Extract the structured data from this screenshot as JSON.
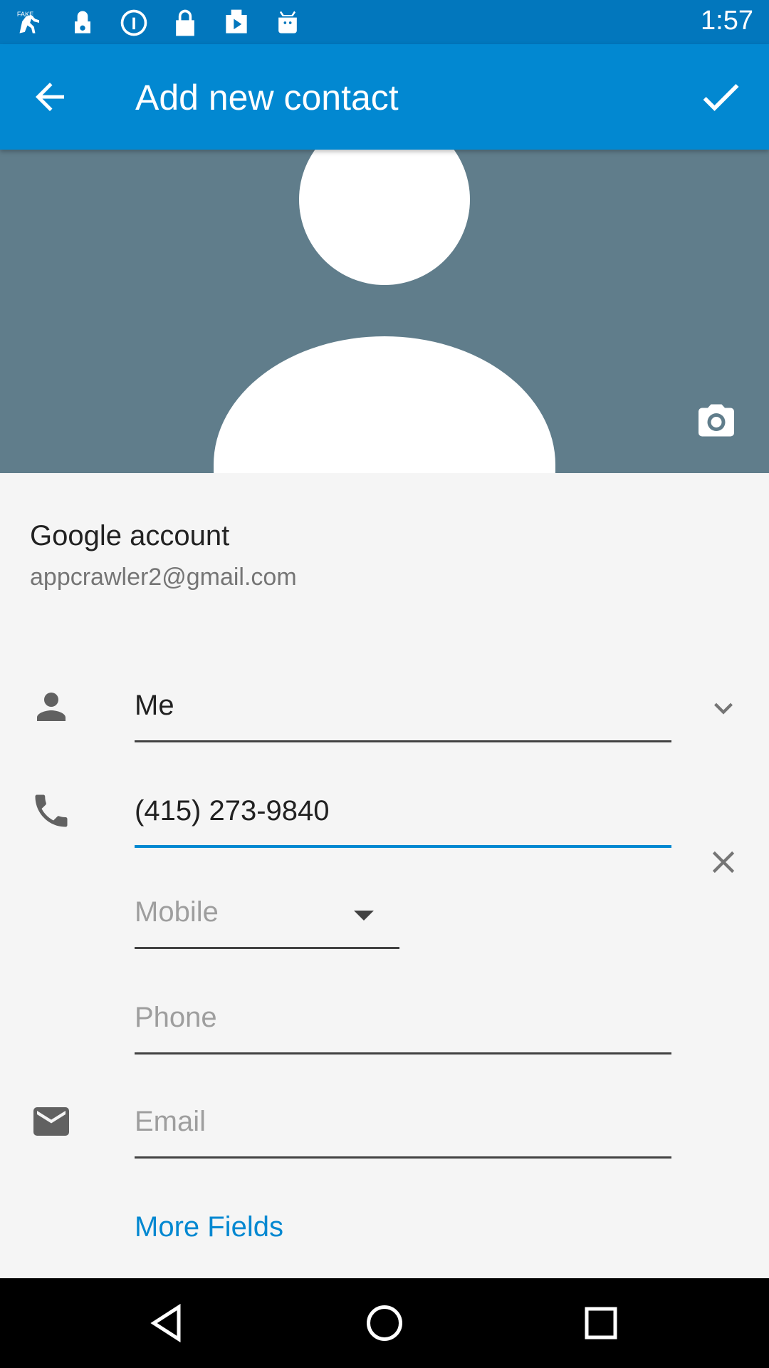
{
  "status_bar": {
    "time": "1:57",
    "icons": [
      "fake-gps-icon",
      "alarm-icon",
      "info-icon",
      "lock-icon",
      "play-store-icon",
      "android-icon"
    ]
  },
  "app_bar": {
    "title": "Add new contact",
    "back_icon": "arrow-back-icon",
    "done_icon": "check-icon"
  },
  "photo": {
    "placeholder_icon": "person-avatar-icon",
    "camera_icon": "camera-icon"
  },
  "account": {
    "label": "Google account",
    "email": "appcrawler2@gmail.com"
  },
  "name": {
    "value": "Me",
    "icon": "person-icon",
    "expand_icon": "chevron-down-icon"
  },
  "phone": {
    "value": "(415) 273-9840",
    "icon": "phone-icon",
    "clear_icon": "close-icon",
    "type_selected": "Mobile",
    "new_placeholder": "Phone"
  },
  "email": {
    "placeholder": "Email",
    "icon": "email-icon"
  },
  "more_fields_label": "More Fields",
  "nav": {
    "back": "back-triangle-icon",
    "home": "home-circle-icon",
    "recents": "recents-square-icon"
  },
  "colors": {
    "status_bar": "#0277bd",
    "app_bar": "#0288d1",
    "photo_bg": "#607d8b",
    "accent": "#0288d1"
  }
}
